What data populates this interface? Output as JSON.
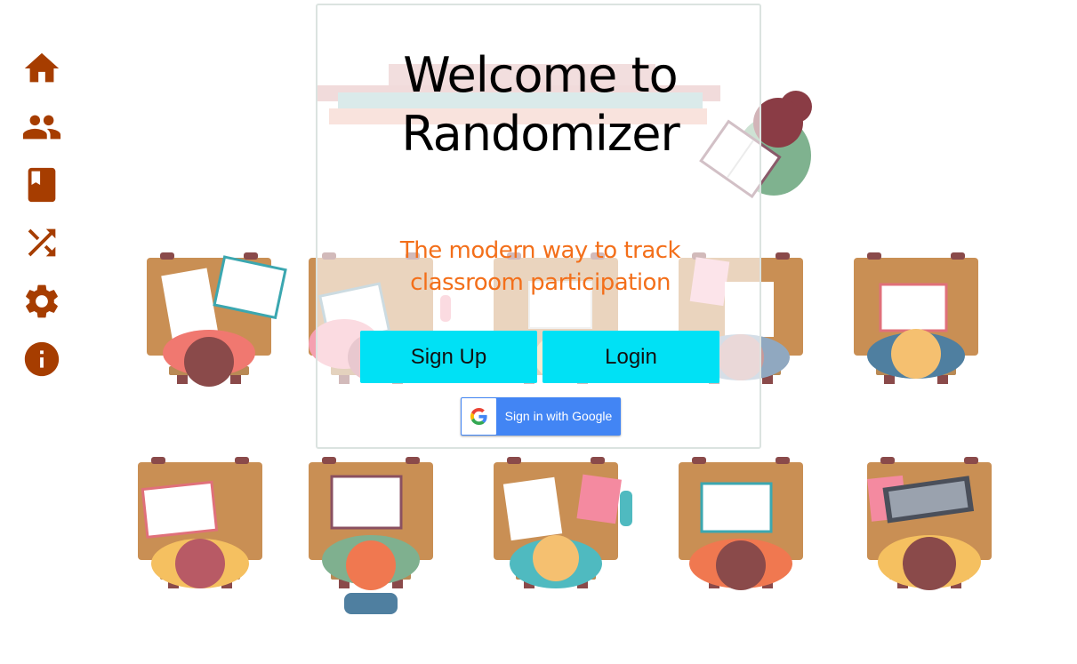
{
  "sidebar": {
    "items": [
      {
        "name": "home",
        "icon": "home-icon"
      },
      {
        "name": "people",
        "icon": "people-icon"
      },
      {
        "name": "book",
        "icon": "book-icon"
      },
      {
        "name": "shuffle",
        "icon": "shuffle-icon"
      },
      {
        "name": "settings",
        "icon": "gear-icon"
      },
      {
        "name": "info",
        "icon": "info-icon"
      }
    ],
    "icon_color": "#a63d00"
  },
  "card": {
    "title_line1": "Welcome to",
    "title_line2": "Randomizer",
    "subtitle_line1": "The modern way to track",
    "subtitle_line2": "classroom participation",
    "signup_label": "Sign Up",
    "login_label": "Login",
    "google_label": "Sign in with Google",
    "accent_color": "#f36f1a",
    "button_color": "#00e1f5"
  }
}
